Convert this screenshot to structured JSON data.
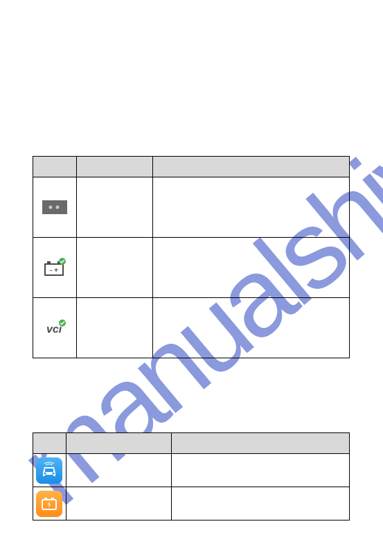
{
  "watermark": "manualshive.com",
  "table1": {
    "headers": [
      "",
      "",
      ""
    ],
    "rows": [
      {
        "icon": "dots-icon"
      },
      {
        "icon": "battery-check-icon"
      },
      {
        "icon": "vci-check-icon"
      }
    ]
  },
  "table2": {
    "headers": [
      "",
      "",
      ""
    ],
    "rows": [
      {
        "icon": "car-app-icon"
      },
      {
        "icon": "charge-app-icon"
      }
    ]
  }
}
